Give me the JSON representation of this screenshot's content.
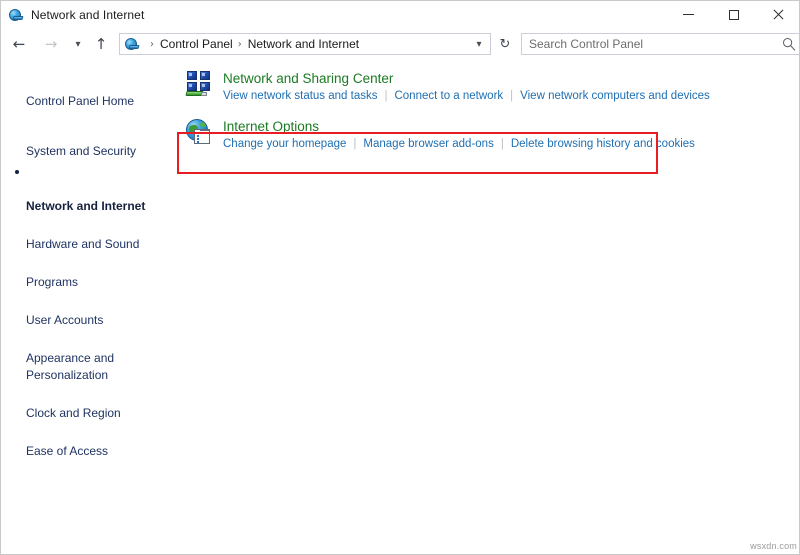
{
  "window": {
    "title": "Network and Internet",
    "icon": "network-globe-icon",
    "controls": {
      "minimize": "Minimize",
      "maximize": "Maximize",
      "close": "Close"
    }
  },
  "nav": {
    "back": "Back",
    "forward": "Forward",
    "recent": "Recent locations",
    "up": "Up one level",
    "refresh": "Refresh",
    "breadcrumb": {
      "icon": "network-globe-icon",
      "items": [
        "Control Panel",
        "Network and Internet"
      ],
      "separator": "›",
      "dropdown": "˅"
    }
  },
  "search": {
    "placeholder": "Search Control Panel",
    "value": "",
    "icon": "search-icon"
  },
  "sidebar": {
    "items": [
      {
        "label": "Control Panel Home",
        "active": false,
        "gap": false
      },
      {
        "label": "System and Security",
        "active": false,
        "gap": true
      },
      {
        "label": "Network and Internet",
        "active": true,
        "gap": false
      },
      {
        "label": "Hardware and Sound",
        "active": false,
        "gap": false
      },
      {
        "label": "Programs",
        "active": false,
        "gap": false
      },
      {
        "label": "User Accounts",
        "active": false,
        "gap": false
      },
      {
        "label": "Appearance and\nPersonalization",
        "active": false,
        "gap": false
      },
      {
        "label": "Clock and Region",
        "active": false,
        "gap": false
      },
      {
        "label": "Ease of Access",
        "active": false,
        "gap": false
      }
    ]
  },
  "categories": [
    {
      "icon": "network-monitors-icon",
      "title": "Network and Sharing Center",
      "links": [
        "View network status and tasks",
        "Connect to a network",
        "View network computers and devices"
      ],
      "highlighted": true
    },
    {
      "icon": "internet-options-globe-icon",
      "title": "Internet Options",
      "links": [
        "Change your homepage",
        "Manage browser add-ons",
        "Delete browsing history and cookies"
      ],
      "highlighted": false
    }
  ],
  "annotation": {
    "highlight_color": "#e81c23"
  },
  "watermark": "wsxdn.com"
}
